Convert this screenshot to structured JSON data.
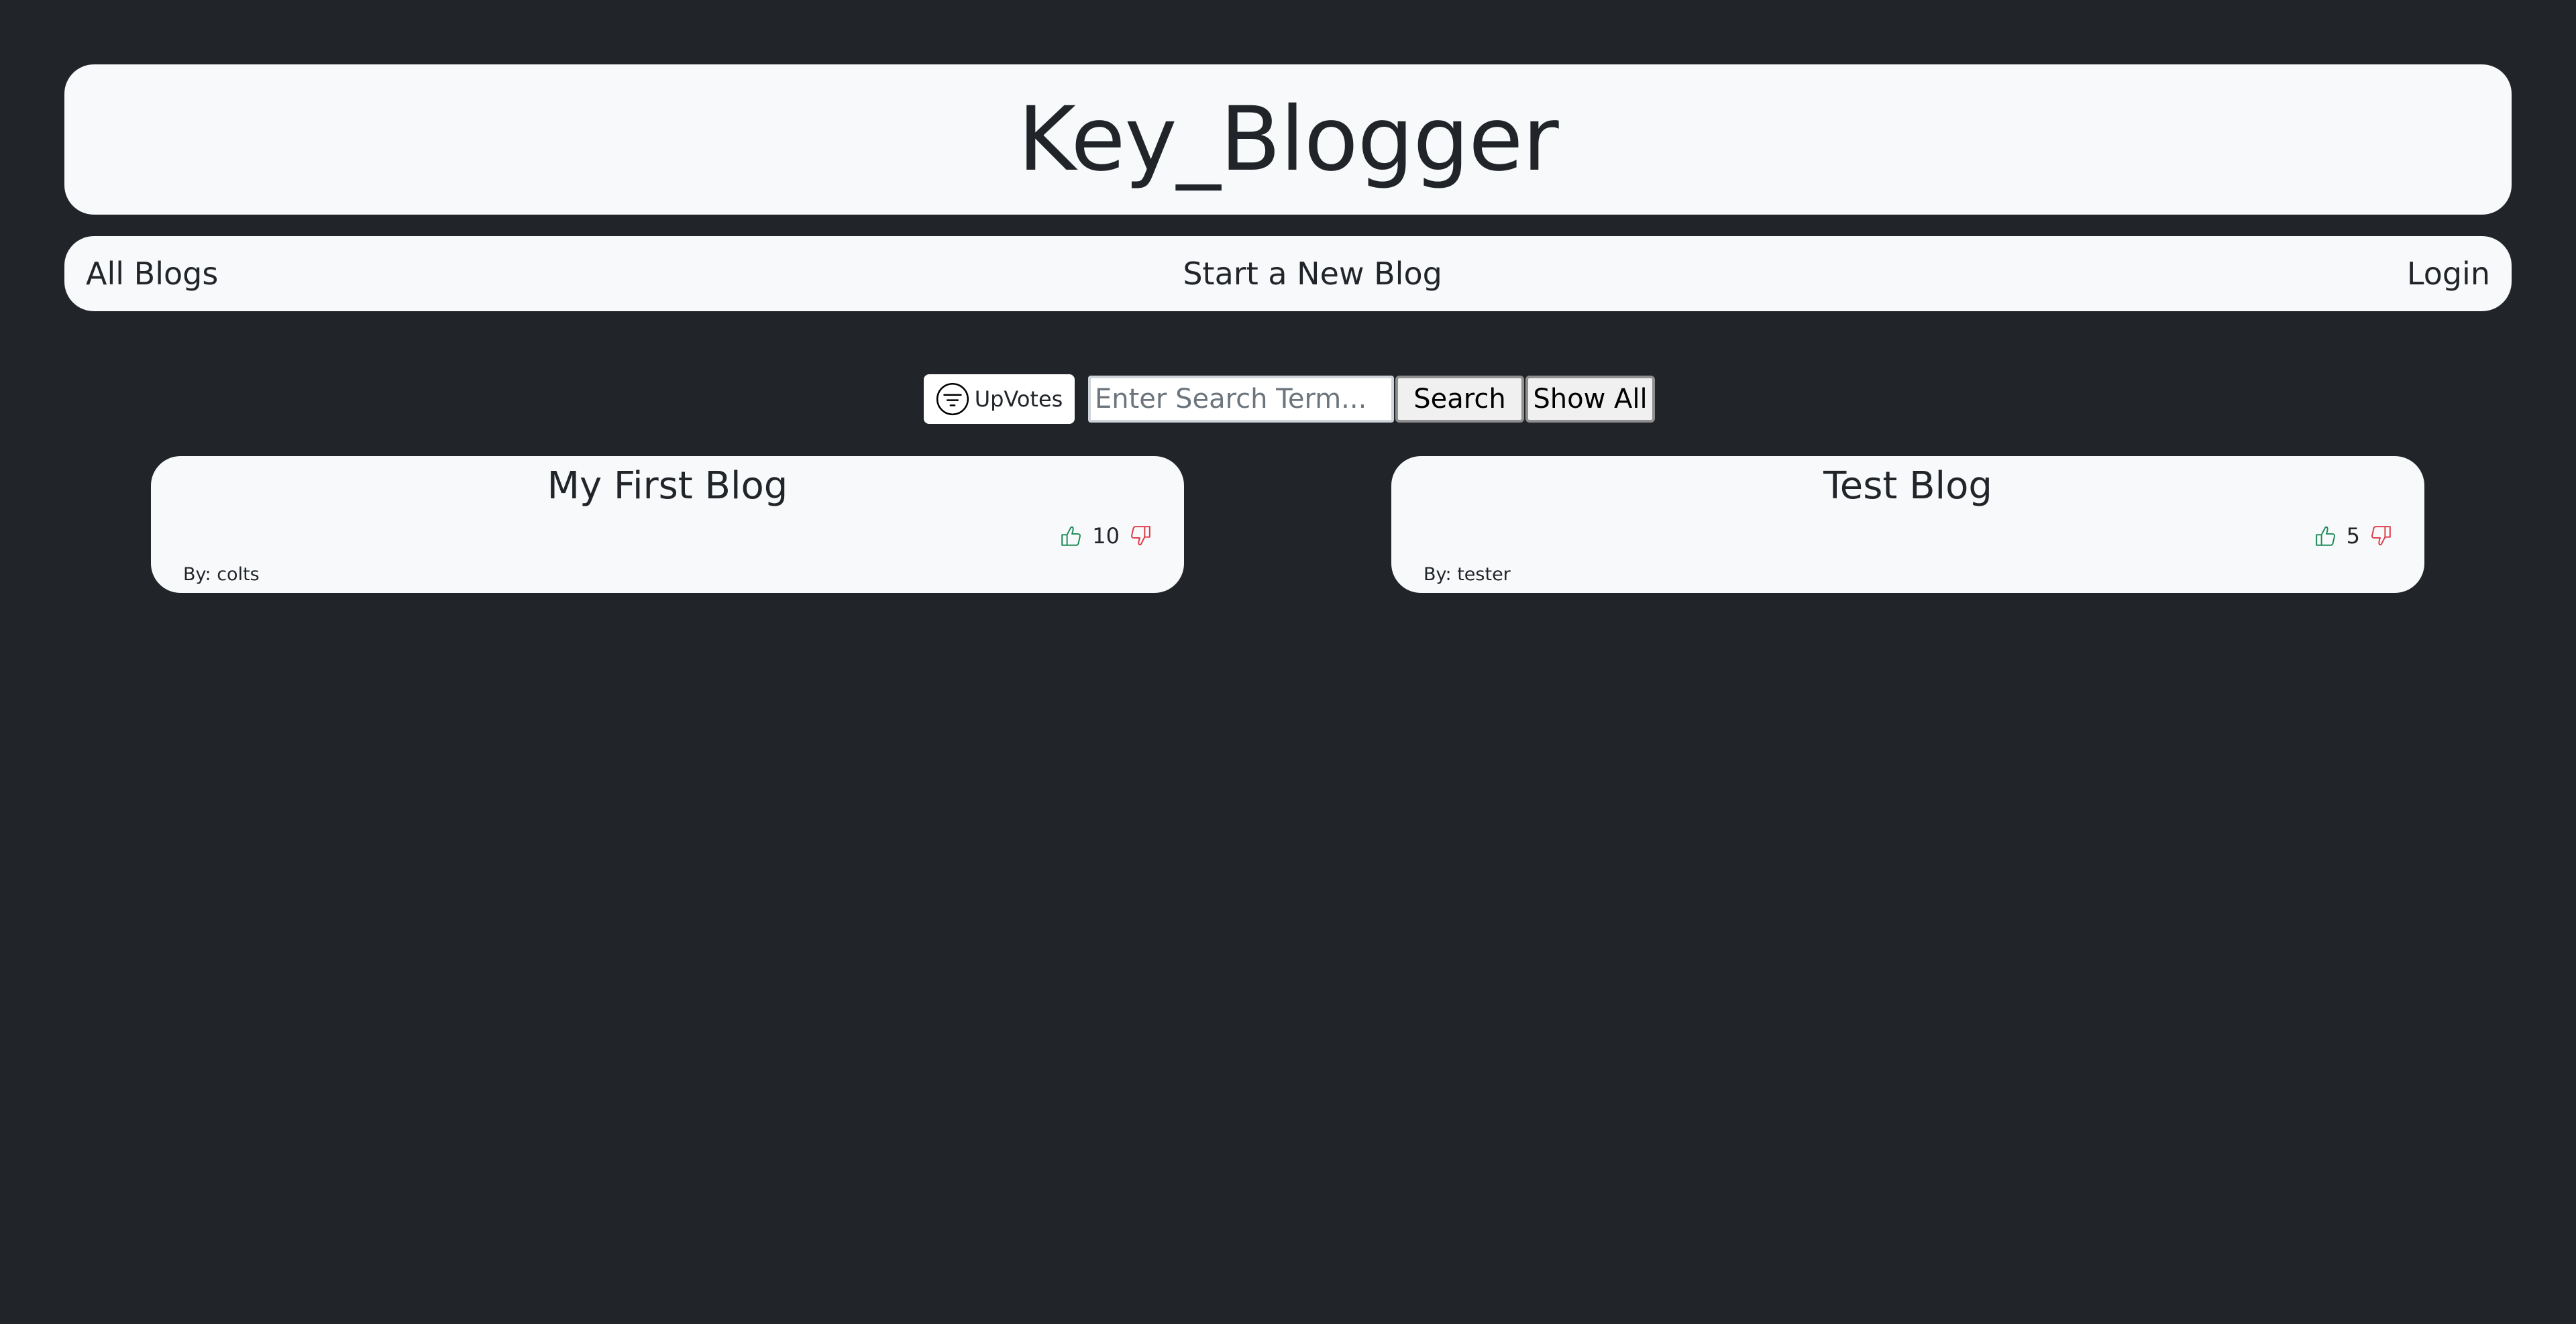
{
  "header": {
    "title": "Key_Blogger"
  },
  "nav": {
    "all_blogs": "All Blogs",
    "new_blog": "Start a New Blog",
    "login": "Login"
  },
  "controls": {
    "filter_label": "UpVotes",
    "filter_icon": "filter-circle-icon",
    "search_placeholder": "Enter Search Term...",
    "search_label": "Search",
    "show_all_label": "Show All"
  },
  "blogs": [
    {
      "title": "My First Blog",
      "votes": "10",
      "author": "By: colts"
    },
    {
      "title": "Test Blog",
      "votes": "5",
      "author": "By: tester"
    }
  ],
  "colors": {
    "background": "#212529",
    "surface": "#f8f9fa",
    "upvote": "#198754",
    "downvote": "#dc3545"
  },
  "icons": {
    "upvote": "thumbs-up-icon",
    "downvote": "thumbs-down-icon"
  }
}
